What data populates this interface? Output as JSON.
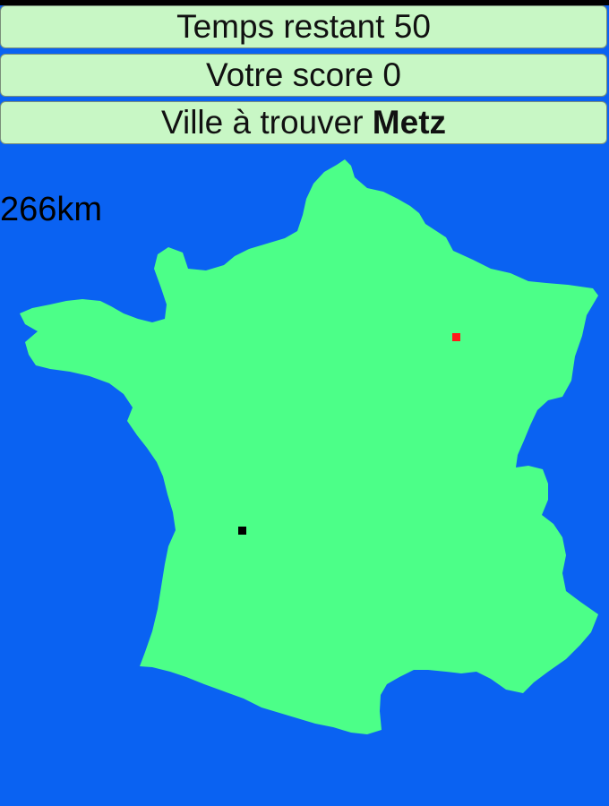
{
  "game": {
    "time_label": "Temps restant",
    "time_value": "50",
    "score_label": "Votre score",
    "score_value": "0",
    "city_label": "Ville à trouver",
    "city_name": "Metz",
    "distance": "266km"
  },
  "map": {
    "country": "France",
    "land_color": "#4cff88",
    "sea_color": "#0a62f2",
    "target_marker_color": "#ff1a1a",
    "guess_marker_color": "#000000"
  }
}
